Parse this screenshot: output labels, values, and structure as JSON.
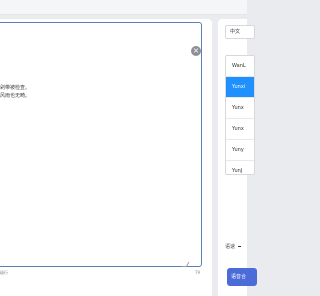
{
  "editor": {
    "text_lines": [
      "剁带被检查。",
      "风雨也无畸。"
    ],
    "meta_left": "级行",
    "meta_right": "79"
  },
  "sidebar": {
    "language_value": "中文",
    "voices": [
      "WanL",
      "Yunxi",
      "Yunx",
      "Yunx",
      "Yuny",
      "YunJ"
    ],
    "selected_voice_index": 1,
    "speed_label": "语速",
    "action_label": "语音合"
  }
}
